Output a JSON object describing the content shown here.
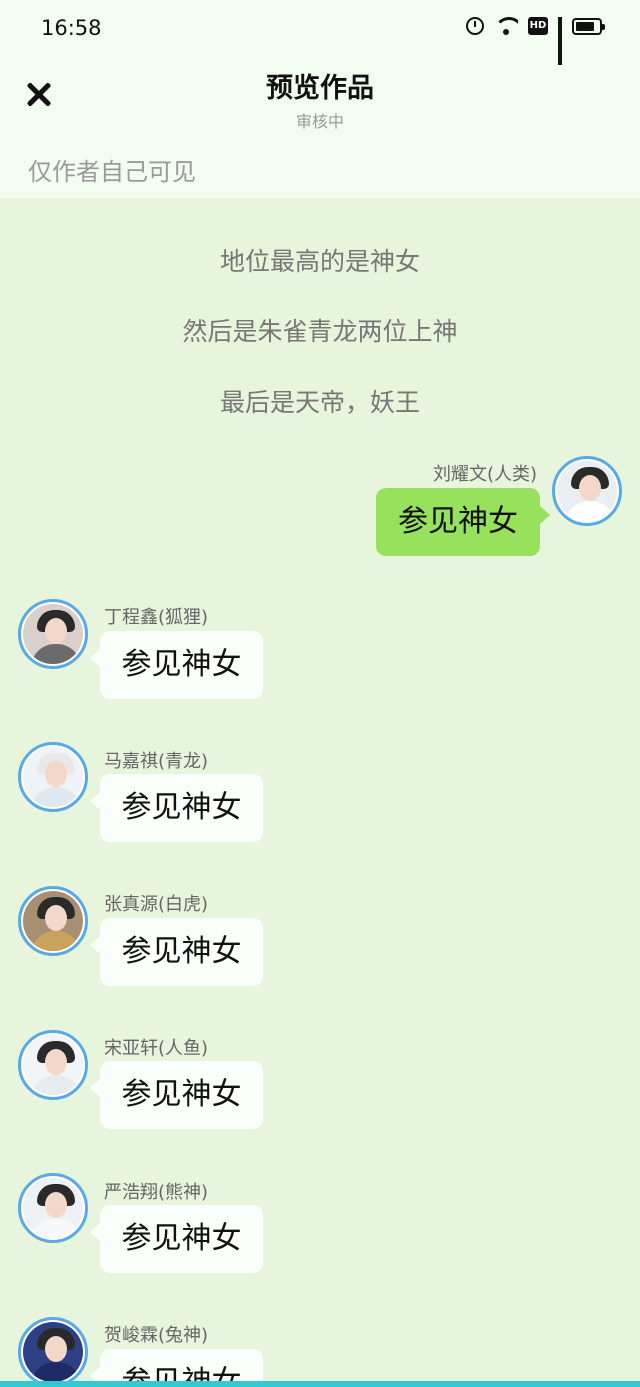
{
  "status_bar": {
    "time": "16:58",
    "icons": [
      "alarm-icon",
      "wifi-icon",
      "hd-icon",
      "4g-signal-icon",
      "battery-icon"
    ]
  },
  "header": {
    "close_icon": "close-icon",
    "title": "预览作品",
    "subtitle": "审核中",
    "visibility_note": "仅作者自己可见"
  },
  "narration": [
    "地位最高的是神女",
    "然后是朱雀青龙两位上神",
    "最后是天帝，妖王"
  ],
  "messages": [
    {
      "side": "right",
      "name": "刘耀文(人类)",
      "text": "参见神女"
    },
    {
      "side": "left",
      "name": "丁程鑫(狐狸)",
      "text": "参见神女"
    },
    {
      "side": "left",
      "name": "马嘉祺(青龙)",
      "text": "参见神女"
    },
    {
      "side": "left",
      "name": "张真源(白虎)",
      "text": "参见神女"
    },
    {
      "side": "left",
      "name": "宋亚轩(人鱼)",
      "text": "参见神女"
    },
    {
      "side": "left",
      "name": "严浩翔(熊神)",
      "text": "参见神女"
    },
    {
      "side": "left",
      "name": "贺峻霖(兔神)",
      "text": "参见神女"
    }
  ],
  "colors": {
    "background": "#e6f5dc",
    "header_background": "#f3fcf1",
    "bubble_right": "#97e15c",
    "bubble_left": "#fafffa",
    "avatar_border": "#5aa9e6",
    "bottom_bar": "#33c9d3"
  }
}
